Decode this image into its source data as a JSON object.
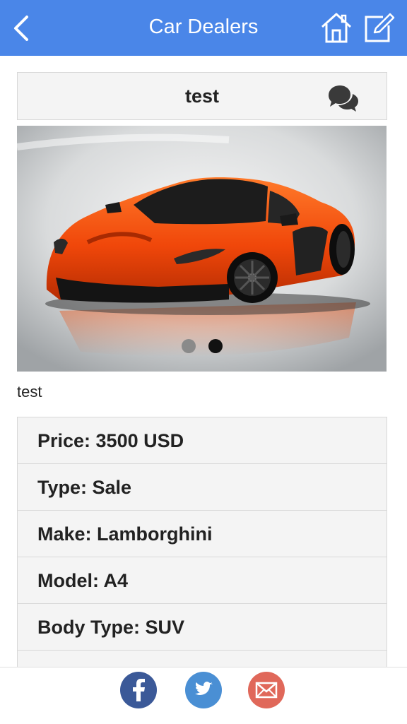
{
  "nav": {
    "title": "Car Dealers",
    "back_icon": "chevron-left-icon",
    "home_icon": "home-icon",
    "edit_icon": "edit-icon",
    "bar_color": "#4a86e8"
  },
  "listing": {
    "title": "test",
    "comment_icon": "chat-bubbles-icon",
    "description": "test",
    "carousel": {
      "slides": 2,
      "active_slide": 2
    }
  },
  "details": {
    "rows": [
      {
        "text": "Price: 3500 USD"
      },
      {
        "text": "Type: Sale"
      },
      {
        "text": "Make: Lamborghini"
      },
      {
        "text": "Model: A4"
      },
      {
        "text": "Body Type: SUV"
      },
      {
        "text": ""
      }
    ]
  },
  "share": {
    "facebook": {
      "icon": "facebook-icon",
      "color": "#3b5998"
    },
    "twitter": {
      "icon": "twitter-icon",
      "color": "#4a8fd4"
    },
    "email": {
      "icon": "mail-icon",
      "color": "#e0685a"
    }
  }
}
